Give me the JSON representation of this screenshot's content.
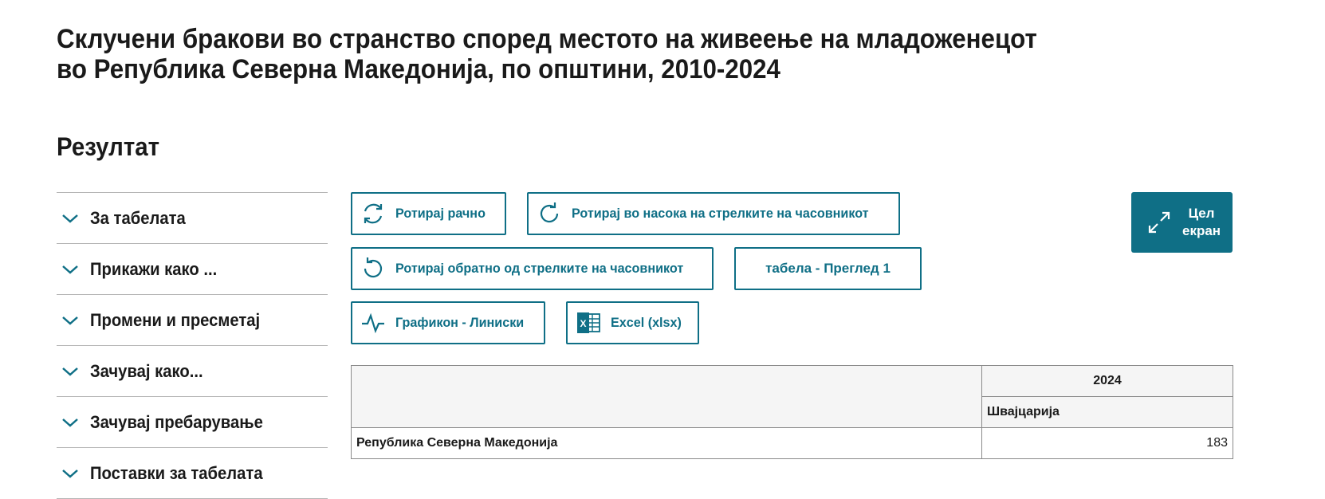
{
  "page": {
    "title": "Склучени бракови во странство според местото на живеење на младоженецот во Република Северна Македонија, по општини, 2010-2024",
    "result_heading": "Резултат"
  },
  "sidebar": {
    "items": [
      {
        "label": "За табелата"
      },
      {
        "label": "Прикажи како ..."
      },
      {
        "label": "Промени и пресметај"
      },
      {
        "label": "Зачувај како..."
      },
      {
        "label": "Зачувај пребарување"
      },
      {
        "label": "Поставки за табелата"
      }
    ]
  },
  "toolbar": {
    "rotate_manual": "Ротирај рачно",
    "rotate_clockwise": "Ротирај во насока на стрелките на часовникот",
    "rotate_counter": "Ротирај обратно од стрелките на часовникот",
    "table_view": "табела - Преглед 1",
    "chart_line": "Графикон - Линиски",
    "excel": "Excel (xlsx)",
    "fullscreen_line1": "Цел",
    "fullscreen_line2": "екран"
  },
  "table": {
    "year": "2024",
    "country": "Швајцарија",
    "rows": [
      {
        "label": "Република Северна Македонија",
        "value": "183"
      }
    ]
  },
  "colors": {
    "accent": "#0f6f86",
    "border": "#8a8a8a"
  }
}
